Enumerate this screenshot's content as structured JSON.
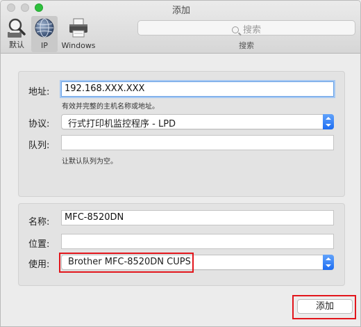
{
  "window": {
    "title": "添加"
  },
  "toolbar": {
    "default_label": "默认",
    "ip_label": "IP",
    "windows_label": "Windows",
    "search_placeholder": "搜索",
    "search_label": "搜索"
  },
  "address": {
    "label": "地址:",
    "value": "192.168.XXX.XXX",
    "hint": "有效并完整的主机名称或地址。"
  },
  "protocol": {
    "label": "协议:",
    "selected": "行式打印机监控程序 - LPD"
  },
  "queue": {
    "label": "队列:",
    "value": "",
    "hint": "让默认队列为空。"
  },
  "name": {
    "label": "名称:",
    "value": "MFC-8520DN"
  },
  "location": {
    "label": "位置:",
    "value": ""
  },
  "use": {
    "label": "使用:",
    "selected": "Brother MFC-8520DN CUPS"
  },
  "footer": {
    "add_label": "添加"
  },
  "colors": {
    "highlight": "#e2151b",
    "accent": "#1c6cf2",
    "tl_max": "#2ec03d"
  }
}
